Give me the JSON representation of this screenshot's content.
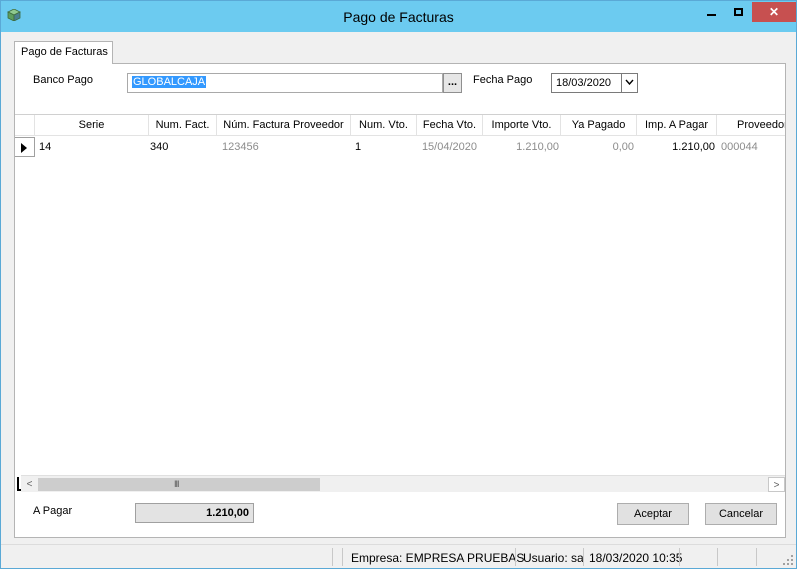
{
  "window": {
    "title": "Pago de Facturas",
    "icon": "app-box-icon",
    "controls": [
      "minimize-icon",
      "maximize-icon",
      "close-icon"
    ],
    "close_glyph": "✕"
  },
  "tab": {
    "label": "Pago de Facturas"
  },
  "form": {
    "banco_label": "Banco Pago",
    "banco_value": "GLOBALCAJA",
    "browse_label": "...",
    "fecha_label": "Fecha Pago",
    "fecha_value": "18/03/2020"
  },
  "grid": {
    "columns": [
      "Serie",
      "Num. Fact.",
      "Núm. Factura Proveedor",
      "Num. Vto.",
      "Fecha Vto.",
      "Importe Vto.",
      "Ya Pagado",
      "Imp. A Pagar",
      "Proveedor"
    ],
    "rows": [
      {
        "serie": "14",
        "num_fact": "340",
        "num_fact_prov": "123456",
        "num_vto": "1",
        "fecha_vto": "15/04/2020",
        "importe_vto": "1.210,00",
        "ya_pagado": "0,00",
        "imp_a_pagar": "1.210,00",
        "proveedor": "000044"
      }
    ],
    "scroll_left": "<",
    "scroll_right": ">",
    "scroll_grip": "III"
  },
  "footer": {
    "apagar_label": "A Pagar",
    "apagar_value": "1.210,00",
    "aceptar_label": "Aceptar",
    "cancelar_label": "Cancelar"
  },
  "status": {
    "empresa": "Empresa: EMPRESA PRUEBAS",
    "usuario": "Usuario: sa",
    "datetime": "18/03/2020 10:35"
  },
  "colors": {
    "titlebar": "#6ccbf0",
    "close_button": "#c75050",
    "selection": "#3399ff",
    "dim_text": "#8c8c8c"
  }
}
